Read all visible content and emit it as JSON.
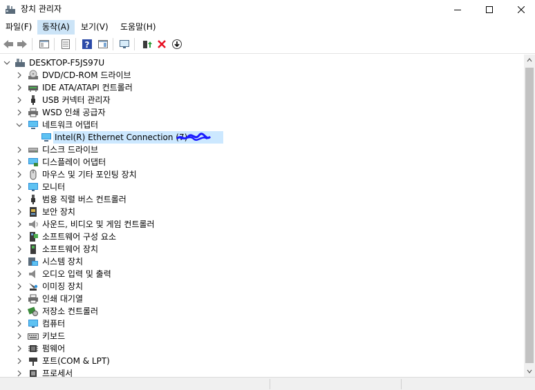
{
  "window": {
    "title": "장치 관리자"
  },
  "menu": {
    "items": [
      {
        "label": "파일(F)"
      },
      {
        "label": "동작(A)"
      },
      {
        "label": "보기(V)"
      },
      {
        "label": "도움말(H)"
      }
    ],
    "active_index": 1
  },
  "tree": {
    "root": "DESKTOP-F5JS97U",
    "categories": [
      {
        "label": "DVD/CD-ROM 드라이브",
        "icon": "dvd-drive-icon"
      },
      {
        "label": "IDE ATA/ATAPI 컨트롤러",
        "icon": "ide-controller-icon"
      },
      {
        "label": "USB 커넥터 관리자",
        "icon": "usb-connector-icon"
      },
      {
        "label": "WSD 인쇄 공급자",
        "icon": "printer-icon"
      },
      {
        "label": "네트워크 어댑터",
        "icon": "network-adapter-icon",
        "expanded": true
      },
      {
        "label": "디스크 드라이브",
        "icon": "disk-drive-icon"
      },
      {
        "label": "디스플레이 어댑터",
        "icon": "display-adapter-icon"
      },
      {
        "label": "마우스 및 기타 포인팅 장치",
        "icon": "mouse-icon"
      },
      {
        "label": "모니터",
        "icon": "monitor-icon"
      },
      {
        "label": "범용 직렬 버스 컨트롤러",
        "icon": "usb-controller-icon"
      },
      {
        "label": "보안 장치",
        "icon": "security-device-icon"
      },
      {
        "label": "사운드, 비디오 및 게임 컨트롤러",
        "icon": "speaker-icon"
      },
      {
        "label": "소프트웨어 구성 요소",
        "icon": "software-component-icon"
      },
      {
        "label": "소프트웨어 장치",
        "icon": "software-device-icon"
      },
      {
        "label": "시스템 장치",
        "icon": "system-device-icon"
      },
      {
        "label": "오디오 입력 및 출력",
        "icon": "audio-icon"
      },
      {
        "label": "이미징 장치",
        "icon": "camera-icon"
      },
      {
        "label": "인쇄 대기열",
        "icon": "print-queue-icon"
      },
      {
        "label": "저장소 컨트롤러",
        "icon": "storage-controller-icon"
      },
      {
        "label": "컴퓨터",
        "icon": "computer-icon"
      },
      {
        "label": "키보드",
        "icon": "keyboard-icon"
      },
      {
        "label": "펌웨어",
        "icon": "firmware-icon"
      },
      {
        "label": "포트(COM & LPT)",
        "icon": "port-icon"
      },
      {
        "label": "프로세서",
        "icon": "processor-icon"
      }
    ],
    "selected_device": {
      "label": "Intel(R) Ethernet Connection (7)",
      "icon": "network-adapter-icon"
    }
  },
  "colors": {
    "selection": "#cce8ff",
    "menu_active": "#cce4f7",
    "delete_red": "#e81123",
    "scribble_blue": "#1a1aff"
  }
}
